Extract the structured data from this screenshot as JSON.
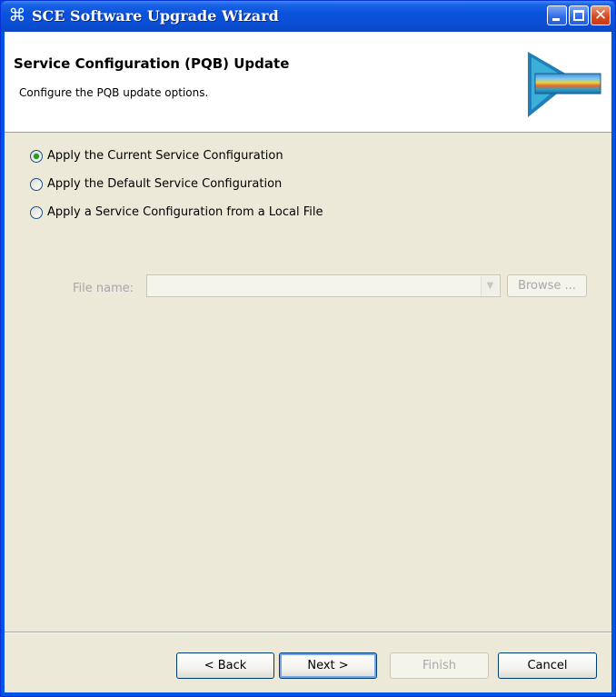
{
  "window": {
    "title": "SCE Software Upgrade Wizard",
    "app_icon_glyph": "⌘",
    "close_glyph": "✕"
  },
  "header": {
    "title": "Service Configuration (PQB) Update",
    "description": "Configure the PQB update options."
  },
  "options": [
    {
      "label": "Apply the Current Service Configuration",
      "selected": true
    },
    {
      "label": "Apply the Default Service Configuration",
      "selected": false
    },
    {
      "label": "Apply a Service Configuration from a Local File",
      "selected": false
    }
  ],
  "file": {
    "label": "File name:",
    "value": "",
    "dropdown_glyph": "▼",
    "browse_label": "Browse ..."
  },
  "buttons": {
    "back": "< Back",
    "next": "Next >",
    "finish": "Finish",
    "cancel": "Cancel"
  },
  "colors": {
    "titlebar": "#0a52dc",
    "dialog_bg": "#ece9d8",
    "selected_radio": "#21a121"
  }
}
